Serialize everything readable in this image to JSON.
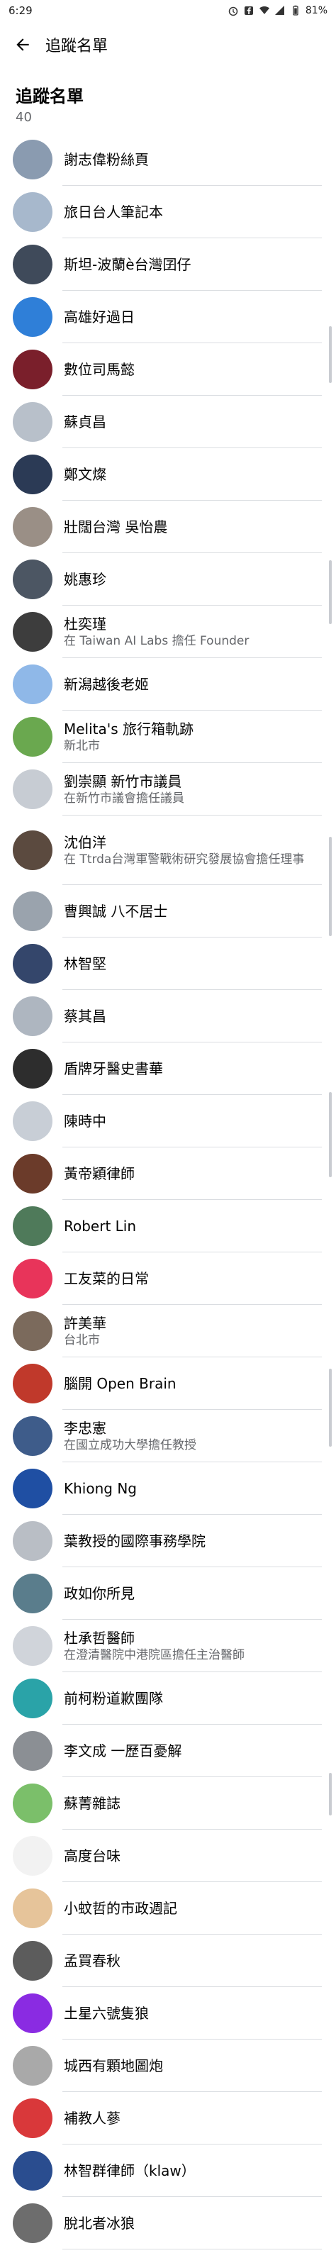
{
  "status_bar": {
    "time": "6:29",
    "battery": "81%"
  },
  "header": {
    "title": "追蹤名單"
  },
  "section": {
    "title": "追蹤名單",
    "count": "40"
  },
  "pages": [
    {
      "name": "謝志偉粉絲頁",
      "sub": "",
      "color": "#8a9bb0"
    },
    {
      "name": "旅日台人筆記本",
      "sub": "",
      "color": "#a7b8cc"
    },
    {
      "name": "斯坦-波蘭è台灣囝仔",
      "sub": "",
      "color": "#3f4a5a"
    },
    {
      "name": "高雄好過日",
      "sub": "",
      "color": "#2f7fd8"
    },
    {
      "name": "數位司馬懿",
      "sub": "",
      "color": "#7a1f2b"
    },
    {
      "name": "蘇貞昌",
      "sub": "",
      "color": "#b8c0ca"
    },
    {
      "name": "鄭文燦",
      "sub": "",
      "color": "#2b3a55"
    },
    {
      "name": "壯闊台灣 吳怡農",
      "sub": "",
      "color": "#9a8f86"
    },
    {
      "name": "姚惠珍",
      "sub": "",
      "color": "#4c5663"
    },
    {
      "name": "杜奕瑾",
      "sub": "在 Taiwan AI Labs 擔任 Founder",
      "color": "#3d3d3d"
    },
    {
      "name": "新潟越後老姬",
      "sub": "",
      "color": "#8fb8e8"
    },
    {
      "name": "Melita's 旅行箱軌跡",
      "sub": "新北市",
      "color": "#6aa84f"
    },
    {
      "name": "劉崇顯 新竹市議員",
      "sub": "在新竹市議會擔任議員",
      "color": "#c7ccd3"
    },
    {
      "name": "沈伯洋",
      "sub": "在 Ttrda台灣軍警戰術研究發展協會擔任理事",
      "color": "#5b4a3f",
      "tall": true
    },
    {
      "name": "曹興誠 八不居士",
      "sub": "",
      "color": "#9aa3ad"
    },
    {
      "name": "林智堅",
      "sub": "",
      "color": "#34466b"
    },
    {
      "name": "蔡其昌",
      "sub": "",
      "color": "#aeb6c0"
    },
    {
      "name": "盾牌牙醫史書華",
      "sub": "",
      "color": "#2d2d2d"
    },
    {
      "name": "陳時中",
      "sub": "",
      "color": "#c8ced6"
    },
    {
      "name": "黃帝穎律師",
      "sub": "",
      "color": "#6b3b2a"
    },
    {
      "name": "Robert Lin",
      "sub": "",
      "color": "#4f7a5a"
    },
    {
      "name": "工友菜的日常",
      "sub": "",
      "color": "#e8345a"
    },
    {
      "name": "許美華",
      "sub": "台北市",
      "color": "#7b6a5c"
    },
    {
      "name": "腦開 Open Brain",
      "sub": "",
      "color": "#c0392b"
    },
    {
      "name": "李忠憲",
      "sub": "在國立成功大學擔任教授",
      "color": "#3e5c8a"
    },
    {
      "name": "Khiong Ng",
      "sub": "",
      "color": "#1f4fa3"
    },
    {
      "name": "葉教授的國際事務學院",
      "sub": "",
      "color": "#b9bec5"
    },
    {
      "name": "政如你所見",
      "sub": "",
      "color": "#5a7d8c"
    },
    {
      "name": "杜承哲醫師",
      "sub": "在澄清醫院中港院區擔任主治醫師",
      "color": "#d0d4da"
    },
    {
      "name": "前柯粉道歉團隊",
      "sub": "",
      "color": "#2aa3a8"
    },
    {
      "name": "李文成 一歷百憂解",
      "sub": "",
      "color": "#8b8f94"
    },
    {
      "name": "蘇菁雜誌",
      "sub": "",
      "color": "#7bbf6a"
    },
    {
      "name": "高度台味",
      "sub": "",
      "color": "#f2f2f2"
    },
    {
      "name": "小蚊哲的市政週記",
      "sub": "",
      "color": "#e6c49a"
    },
    {
      "name": "孟買春秋",
      "sub": "",
      "color": "#5c5c5c"
    },
    {
      "name": "土星六號隻狼",
      "sub": "",
      "color": "#8a2be2"
    },
    {
      "name": "城西有顆地圖炮",
      "sub": "",
      "color": "#a9a9a9"
    },
    {
      "name": "補教人蔘",
      "sub": "",
      "color": "#d9383a"
    },
    {
      "name": "林智群律師（klaw）",
      "sub": "",
      "color": "#2a4d8f"
    },
    {
      "name": "脫北者冰狼",
      "sub": "",
      "color": "#6d6d6d"
    }
  ]
}
